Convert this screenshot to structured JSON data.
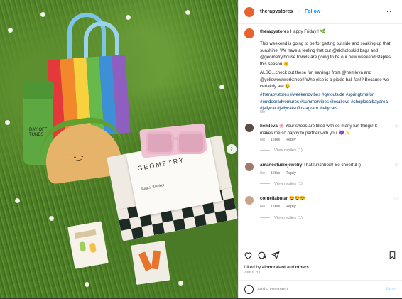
{
  "header": {
    "username": "therapystores",
    "separator": "•",
    "follow_label": "Follow",
    "more_label": "···"
  },
  "caption": {
    "username": "therapystores",
    "line1": "Happy Friday!! 🌿",
    "line2": "This weekend is going to be for getting outside and soaking up that sunshine! We have a feeling that our @elcholoskid bags and @geometry.house towels are going to be our new weekend staples this season 🌞",
    "line3": "ALSO...check out these fun earrings from @hemleva and @yellowowlworkshop!! Who else is a pickle ball fan!? Because we certainly are 😜",
    "hashtags": "#therapystores #weekendvibes #getoutside #springtimefun #outdooradventures #summervibes #locallove #shoplocalbayarea #jellycat #jellycatsofinstagram #jellycats",
    "time": "6w"
  },
  "comments": [
    {
      "username": "hemleva",
      "text": "🌸 Your shops are filled with so many fun things! It makes me so happy to partner with you. 💜✨",
      "time": "6w",
      "likes": "1 like",
      "reply": "Reply",
      "view_replies": "View replies (1)"
    },
    {
      "username": "amanostudiojewelry",
      "text": "That lunchbox!! So cheerful :)",
      "time": "6w",
      "likes": "1 like",
      "reply": "Reply",
      "view_replies": "View replies (1)"
    },
    {
      "username": "corneliabutar",
      "text": "😍😍😍",
      "time": "6w",
      "likes": "1 like",
      "reply": "Reply",
      "view_replies": "View replies (1)"
    }
  ],
  "footer": {
    "liked_by_prefix": "Liked by ",
    "liked_by_user": "alondralaot",
    "liked_by_suffix": " and ",
    "liked_by_others": "others",
    "date": "APRIL 21",
    "add_comment_placeholder": "Add a comment...",
    "post_label": "Post"
  },
  "photo": {
    "bottle_text": "DAY OFF TUNES",
    "book_text": "GEOMETRY",
    "card_text": "Beach Blanket",
    "next_arrow": "›"
  },
  "colors": {
    "accent_avatar": "#e8622d",
    "follow_blue": "#0095f6",
    "text": "#262626",
    "muted": "#8e8e8e"
  }
}
